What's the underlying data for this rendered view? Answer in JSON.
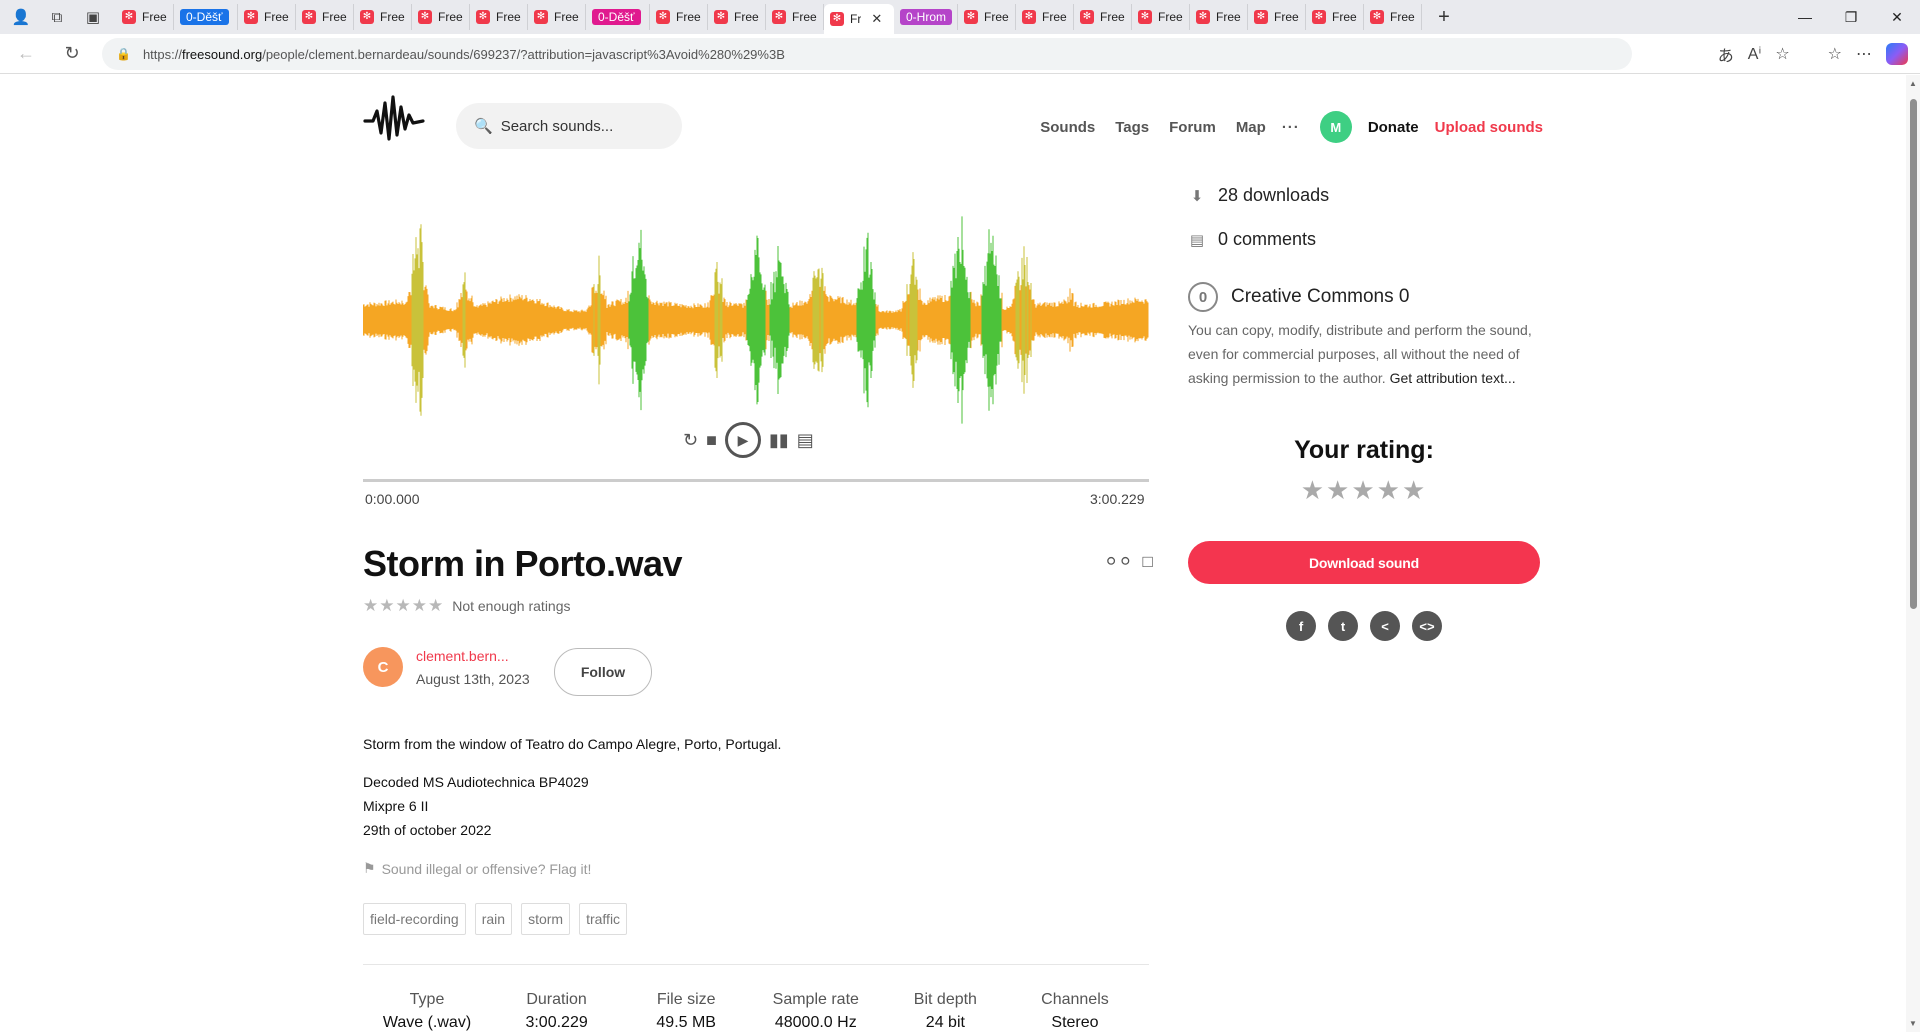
{
  "browser": {
    "tabs": [
      {
        "label": "Freeso",
        "type": "normal"
      },
      {
        "label": "0-Děšť",
        "type": "pill",
        "color": "#1a73e8"
      },
      {
        "label": "Freeso",
        "type": "normal"
      },
      {
        "label": "Freeso",
        "type": "normal"
      },
      {
        "label": "Freeso",
        "type": "normal"
      },
      {
        "label": "Freeso",
        "type": "normal"
      },
      {
        "label": "Freeso",
        "type": "normal"
      },
      {
        "label": "Freeso",
        "type": "normal"
      },
      {
        "label": "0-Děšť",
        "type": "pill",
        "color": "#e01a8f"
      },
      {
        "label": "Freeso",
        "type": "normal"
      },
      {
        "label": "Freeso",
        "type": "normal"
      },
      {
        "label": "Freeso",
        "type": "normal"
      },
      {
        "label": "Fr",
        "type": "active"
      },
      {
        "label": "0-Hrom",
        "type": "pill",
        "color": "#b544c9"
      },
      {
        "label": "Freeso",
        "type": "normal"
      },
      {
        "label": "Freeso",
        "type": "normal"
      },
      {
        "label": "Freeso",
        "type": "normal"
      },
      {
        "label": "Freeso",
        "type": "normal"
      },
      {
        "label": "Freeso",
        "type": "normal"
      },
      {
        "label": "Freeso",
        "type": "normal"
      },
      {
        "label": "Freeso",
        "type": "normal"
      },
      {
        "label": "Freeso",
        "type": "normal"
      }
    ],
    "url_scheme": "https://",
    "url_host": "freesound.org",
    "url_path": "/people/clement.bernardeau/sounds/699237/?attribution=javascript%3Avoid%280%29%3B"
  },
  "header": {
    "search_placeholder": "Search sounds...",
    "nav": [
      "Sounds",
      "Tags",
      "Forum",
      "Map"
    ],
    "more": "···",
    "avatar_letter": "M",
    "donate": "Donate",
    "upload": "Upload sounds"
  },
  "player": {
    "time_start": "0:00.000",
    "time_end": "3:00.229"
  },
  "sound": {
    "title": "Storm in Porto.wav",
    "stars": "★★★★★",
    "rating_text": "Not enough ratings",
    "author_initial": "C",
    "author_name": "clement.bern...",
    "date": "August 13th, 2023",
    "follow_label": "Follow",
    "description_line1": "Storm from the window of Teatro do Campo Alegre, Porto, Portugal.",
    "description_line2": "Decoded MS Audiotechnica BP4029",
    "description_line3": "Mixpre 6 II",
    "description_line4": "29th of october 2022",
    "flag_text": "Sound illegal or offensive? Flag it!",
    "tags": [
      "field-recording",
      "rain",
      "storm",
      "traffic"
    ],
    "specs": [
      {
        "label": "Type",
        "value": "Wave (.wav)"
      },
      {
        "label": "Duration",
        "value": "3:00.229"
      },
      {
        "label": "File size",
        "value": "49.5 MB"
      },
      {
        "label": "Sample rate",
        "value": "48000.0 Hz"
      },
      {
        "label": "Bit depth",
        "value": "24 bit"
      },
      {
        "label": "Channels",
        "value": "Stereo"
      }
    ]
  },
  "sidebar": {
    "downloads": "28 downloads",
    "comments": "0 comments",
    "license_title": "Creative Commons 0",
    "license_badge": "0",
    "license_text": "You can copy, modify, distribute and perform the sound, even for commercial purposes, all without the need of asking permission to the author.",
    "attribution_link": "Get attribution text...",
    "your_rating": "Your rating:",
    "rating_stars": "★★★★★",
    "download_label": "Download sound",
    "share": [
      "f",
      "t",
      "<",
      "<>"
    ]
  },
  "colors": {
    "brand_red": "#f0394b",
    "download_red": "#f4354f",
    "wave_orange": "#f5a623",
    "wave_green": "#4cc23a"
  }
}
